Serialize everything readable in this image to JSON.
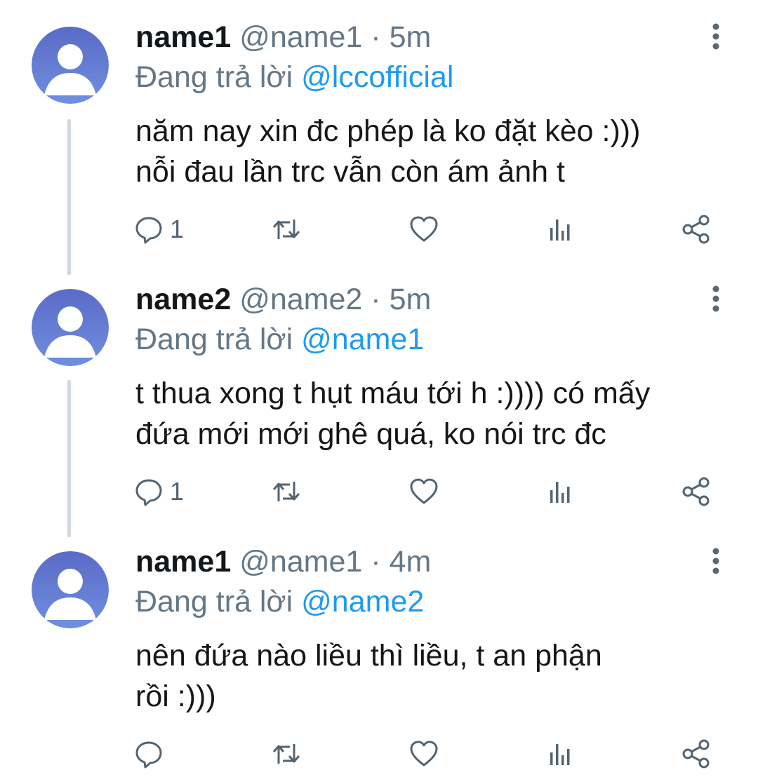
{
  "tweets": [
    {
      "name": "name1",
      "handle": "@name1",
      "separator": "·",
      "time": "5m",
      "reply_prefix": "Đang trả lời",
      "reply_to": "@lccofficial",
      "lines": [
        "năm nay xin đc phép là ko đặt kèo :)))",
        "nỗi đau lần trc vẫn còn ám ảnh t"
      ],
      "reply_count": "1"
    },
    {
      "name": "name2",
      "handle": "@name2",
      "separator": "·",
      "time": "5m",
      "reply_prefix": "Đang trả lời",
      "reply_to": "@name1",
      "lines": [
        "t thua xong t hụt máu tới h :)))) có mấy",
        "đứa mới mới ghê quá, ko nói trc đc"
      ],
      "reply_count": "1"
    },
    {
      "name": "name1",
      "handle": "@name1",
      "separator": "·",
      "time": "4m",
      "reply_prefix": "Đang trả lời",
      "reply_to": "@name2",
      "lines": [
        "nên đứa nào liều thì liều, t an phận",
        "rồi :)))"
      ],
      "reply_count": ""
    }
  ],
  "icons": {
    "reply": "reply-icon",
    "retweet": "retweet-icon",
    "like": "heart-icon",
    "analytics": "analytics-icon",
    "share": "share-icon",
    "more": "more-vertical-icon",
    "avatar": "default-avatar-icon"
  },
  "colors": {
    "mention": "#1d9bf0",
    "secondary_text": "#657786",
    "avatar_top": "#5b6bc7",
    "avatar_bottom": "#6f8fe0",
    "thread_line": "#cfd9de"
  }
}
